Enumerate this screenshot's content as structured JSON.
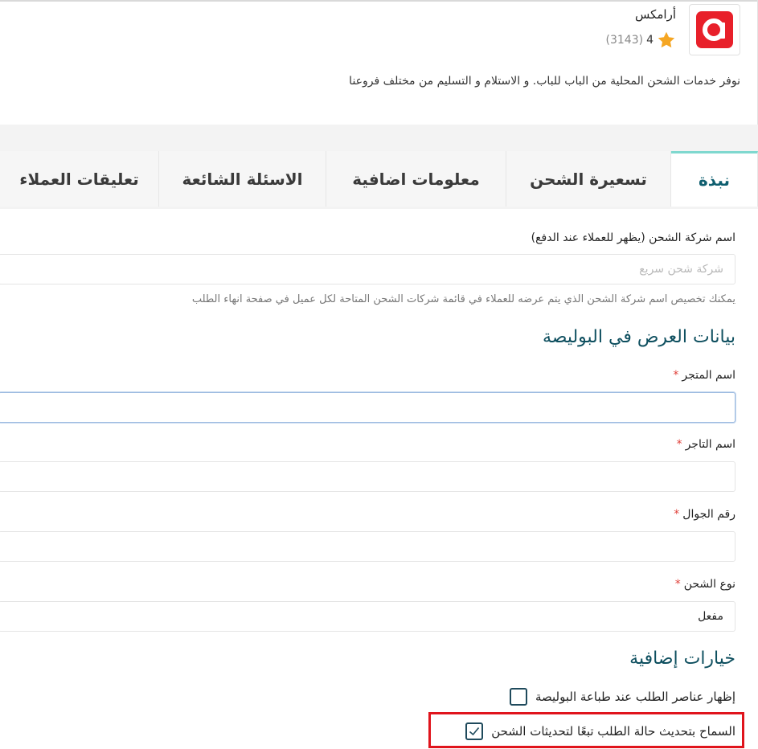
{
  "provider": {
    "name": "أرامكس",
    "rating_value": "4",
    "rating_count": "(3143)",
    "description": "نوفر خدمات الشحن المحلية من الباب للباب. و الاستلام و التسليم من مختلف فروعنا",
    "brand_color": "#e8202a"
  },
  "tabs": [
    {
      "label": "نبذة",
      "active": true
    },
    {
      "label": "تسعيرة الشحن",
      "active": false
    },
    {
      "label": "معلومات اضافية",
      "active": false
    },
    {
      "label": "الاسئلة الشائعة",
      "active": false
    },
    {
      "label": "تعليقات العملاء",
      "active": false
    }
  ],
  "shipping_company": {
    "label": "اسم شركة الشحن (يظهر للعملاء عند الدفع)",
    "placeholder": "شركة شحن سريع",
    "value": "",
    "help": "يمكنك تخصيص اسم شركة الشحن الذي يتم عرضه للعملاء في قائمة شركات الشحن المتاحة لكل عميل في صفحة انهاء الطلب"
  },
  "waybill_section": {
    "title": "بيانات العرض في البوليصة",
    "store_name": {
      "label": "اسم المتجر",
      "required_mark": "*",
      "value": ""
    },
    "merchant_name": {
      "label": "اسم التاجر",
      "required_mark": "*",
      "value": ""
    },
    "mobile": {
      "label": "رقم الجوال",
      "required_mark": "*",
      "value": ""
    },
    "shipping_type": {
      "label": "نوع الشحن",
      "required_mark": "*",
      "value": "مفعل"
    }
  },
  "extra_options": {
    "title": "خيارات إضافية",
    "show_items": {
      "label": "إظهار عناصر الطلب عند طباعة البوليصة",
      "checked": false
    },
    "auto_update": {
      "label": "السماح بتحديث حالة الطلب تبعًا لتحديثات الشحن",
      "checked": true
    }
  },
  "colors": {
    "accent": "#0e5e6f",
    "active_tab_border": "#7fd8cf",
    "required": "#e0413a",
    "highlight": "#e0141c"
  }
}
